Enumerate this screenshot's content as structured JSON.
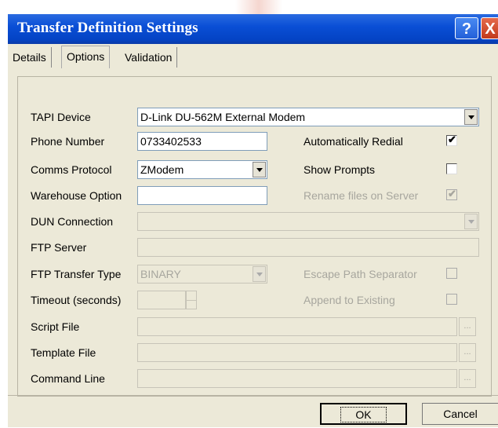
{
  "window": {
    "title": "Transfer Definition Settings"
  },
  "titlebar_buttons": {
    "help": "?",
    "close": "X"
  },
  "tabs": [
    {
      "label": "Details",
      "active": false
    },
    {
      "label": "Options",
      "active": true
    },
    {
      "label": "Validation",
      "active": false
    }
  ],
  "form": {
    "tapi_device": {
      "label": "TAPI Device",
      "value": "D-Link DU-562M External Modem"
    },
    "phone_number": {
      "label": "Phone Number",
      "value": "0733402533"
    },
    "comms_protocol": {
      "label": "Comms Protocol",
      "value": "ZModem"
    },
    "warehouse_option": {
      "label": "Warehouse Option",
      "value": ""
    },
    "dun_connection": {
      "label": "DUN Connection",
      "value": ""
    },
    "ftp_server": {
      "label": "FTP Server",
      "value": ""
    },
    "ftp_transfer_type": {
      "label": "FTP Transfer Type",
      "value": "BINARY"
    },
    "timeout": {
      "label": "Timeout (seconds)",
      "value": ""
    },
    "script_file": {
      "label": "Script File",
      "value": ""
    },
    "template_file": {
      "label": "Template File",
      "value": ""
    },
    "command_line": {
      "label": "Command Line",
      "value": ""
    },
    "browse_label": "..."
  },
  "options": {
    "auto_redial": {
      "label": "Automatically Redial",
      "checked": true,
      "enabled": true
    },
    "show_prompts": {
      "label": "Show Prompts",
      "checked": false,
      "enabled": true
    },
    "rename_files": {
      "label": "Rename files on Server",
      "checked": true,
      "enabled": false
    },
    "escape_path": {
      "label": "Escape Path Separator",
      "checked": false,
      "enabled": false
    },
    "append_existing": {
      "label": "Append to Existing",
      "checked": false,
      "enabled": false
    }
  },
  "footer": {
    "ok_label": "OK",
    "cancel_label": "Cancel"
  },
  "colors": {
    "titlebar": "#0a4fd6",
    "dialog_bg": "#ece9d8",
    "disabled_text": "#a7a69e"
  },
  "check_glyph": "✔"
}
